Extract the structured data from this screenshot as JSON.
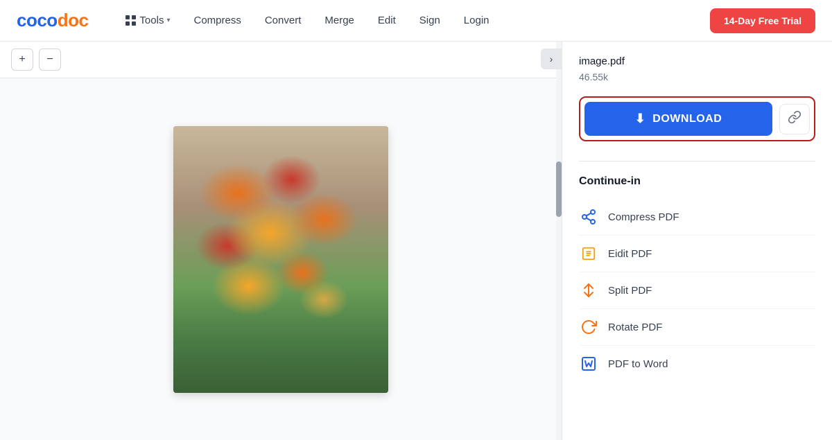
{
  "header": {
    "logo_coco": "coco",
    "logo_doc": "doc",
    "tools_label": "Tools",
    "compress_label": "Compress",
    "convert_label": "Convert",
    "merge_label": "Merge",
    "edit_label": "Edit",
    "sign_label": "Sign",
    "login_label": "Login",
    "trial_label": "14-Day Free Trial"
  },
  "toolbar": {
    "zoom_in_icon": "+",
    "zoom_out_icon": "−",
    "collapse_icon": "›"
  },
  "right_panel": {
    "file_name": "image.pdf",
    "file_size": "46.55k",
    "download_label": "DOWNLOAD",
    "link_icon": "🔗",
    "continue_title": "Continue-in",
    "items": [
      {
        "label": "Compress PDF",
        "icon_type": "compress"
      },
      {
        "label": "Eidit PDF",
        "icon_type": "edit"
      },
      {
        "label": "Split PDF",
        "icon_type": "split"
      },
      {
        "label": "Rotate PDF",
        "icon_type": "rotate"
      },
      {
        "label": "PDF to Word",
        "icon_type": "word"
      }
    ]
  }
}
